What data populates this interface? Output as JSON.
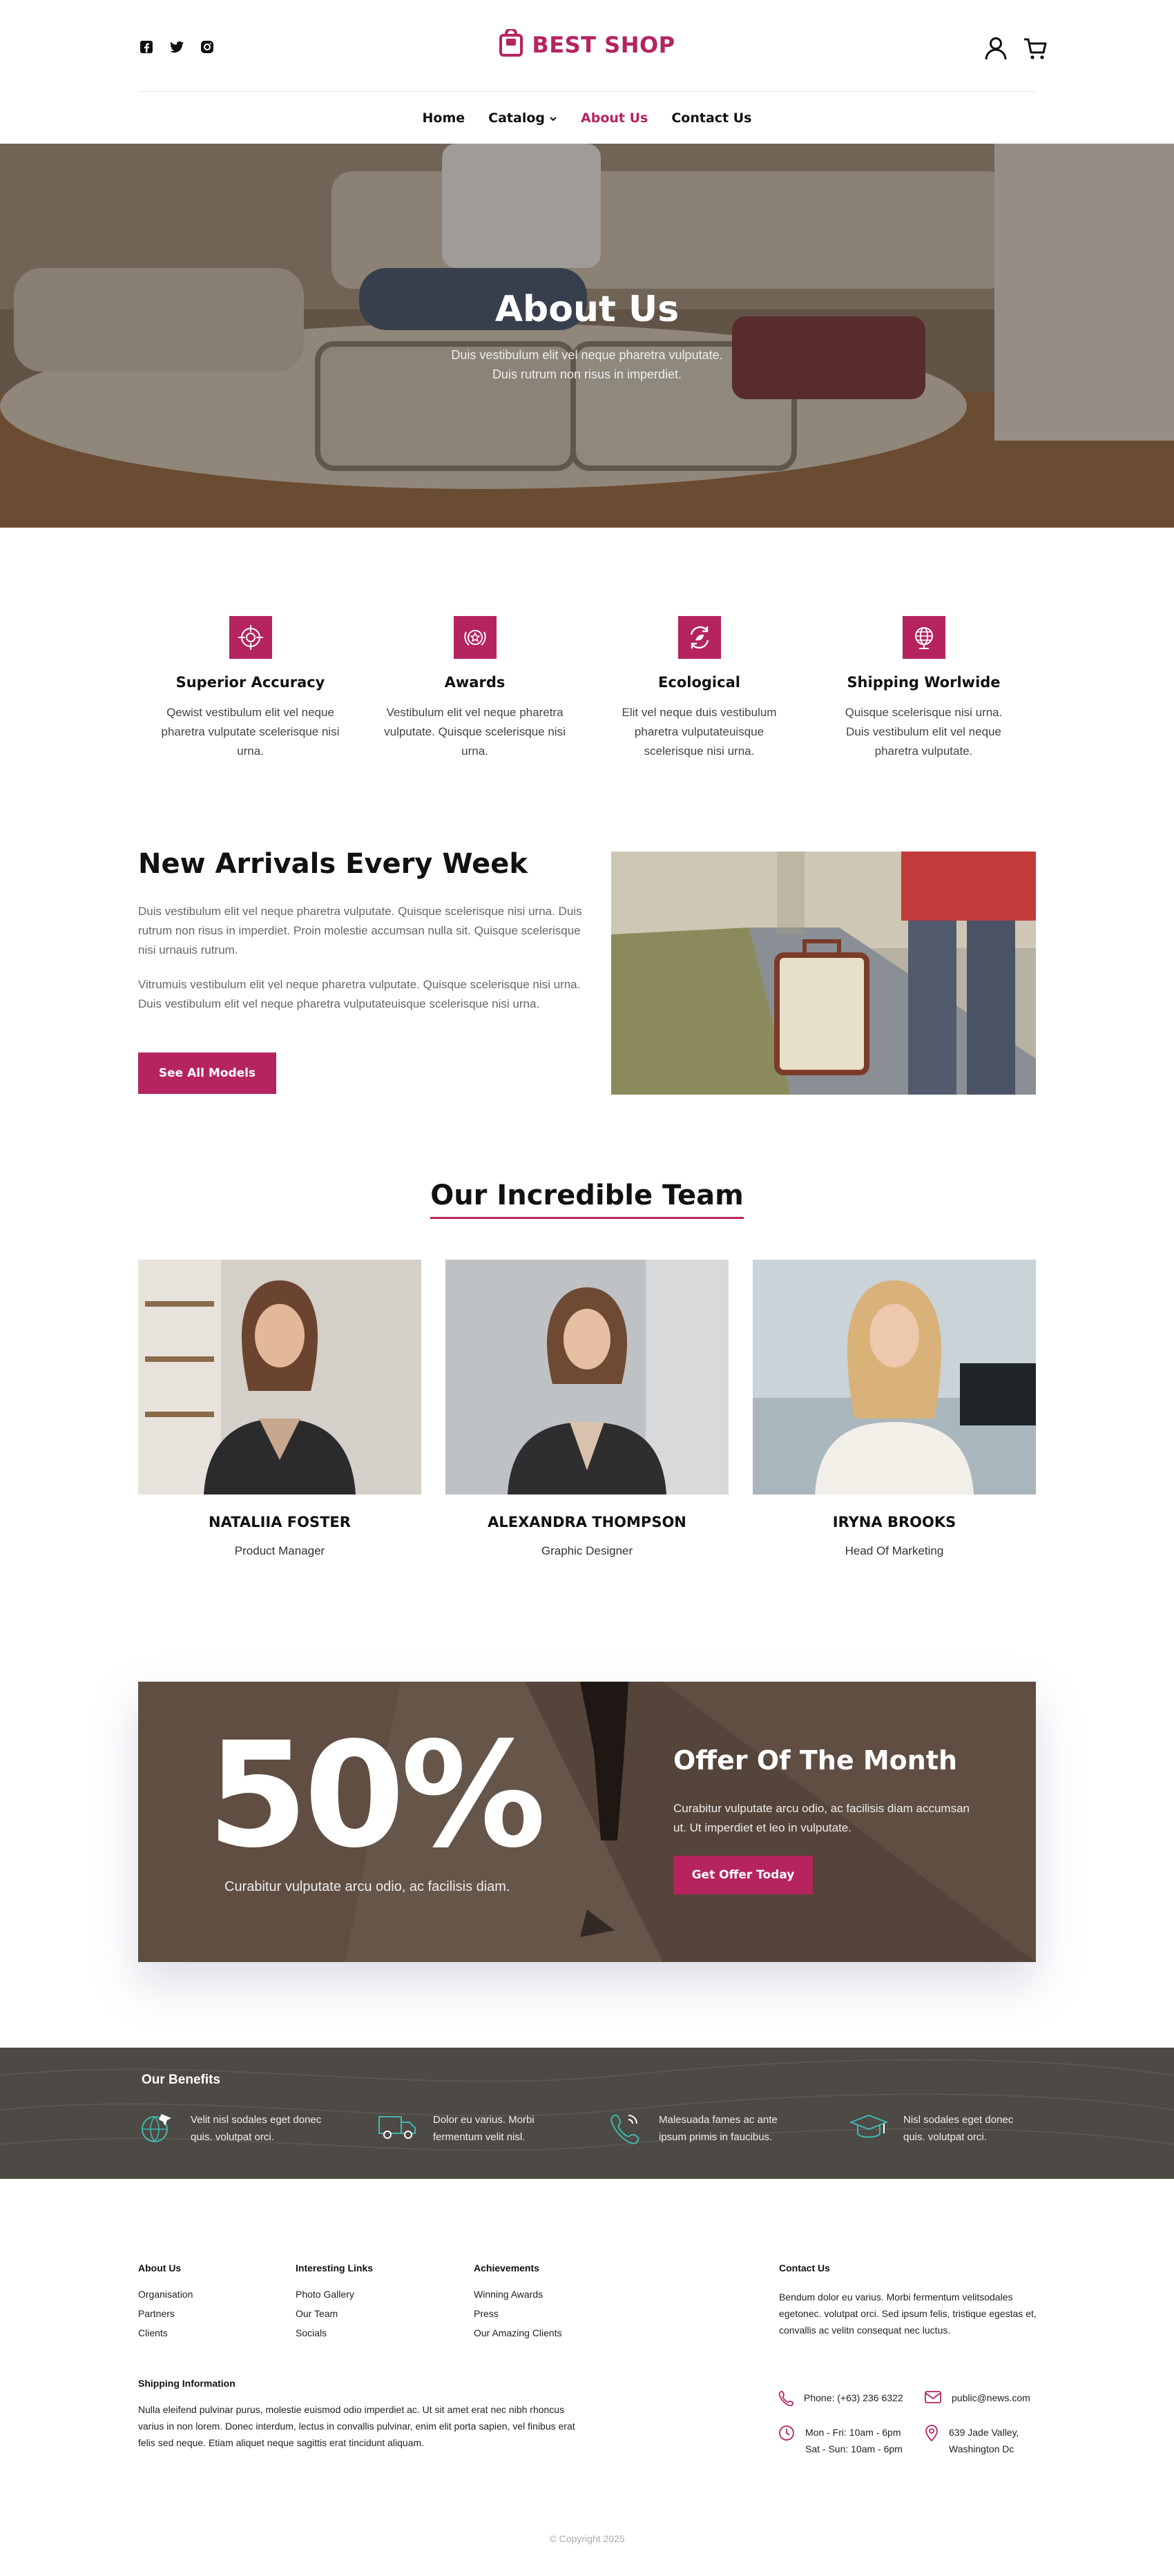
{
  "brand": {
    "name": "BEST SHOP",
    "accent": "#b5245f"
  },
  "header": {
    "social": [
      "facebook-icon",
      "twitter-icon",
      "instagram-icon"
    ],
    "icons": [
      "user-icon",
      "cart-icon"
    ]
  },
  "nav": {
    "items": [
      {
        "label": "Home"
      },
      {
        "label": "Catalog"
      },
      {
        "label": "About Us"
      },
      {
        "label": "Contact Us"
      }
    ],
    "active": "About Us"
  },
  "hero": {
    "title": "About Us",
    "line1": "Duis vestibulum elit vel neque pharetra vulputate.",
    "line2": "Duis rutrum non risus in imperdiet."
  },
  "features": [
    {
      "icon": "target-icon",
      "title": "Superior Accuracy",
      "text": "Qewist vestibulum elit vel neque pharetra vulputate scelerisque nisi urna."
    },
    {
      "icon": "award-icon",
      "title": "Awards",
      "text": "Vestibulum elit vel neque pharetra vulputate. Quisque scelerisque nisi urna."
    },
    {
      "icon": "recycle-icon",
      "title": "Ecological",
      "text": "Elit vel neque duis vestibulum pharetra vulputateuisque scelerisque nisi urna."
    },
    {
      "icon": "globe-icon",
      "title": "Shipping Worlwide",
      "text": "Quisque scelerisque nisi urna. Duis vestibulum elit vel neque pharetra vulputate."
    }
  ],
  "arrivals": {
    "title": "New Arrivals Every Week",
    "p1": "Duis vestibulum elit vel neque pharetra vulputate. Quisque scelerisque nisi urna. Duis rutrum non risus in imperdiet. Proin molestie accumsan nulla sit. Quisque scelerisque nisi urnauis rutrum.",
    "p2": "Vitrumuis vestibulum elit vel neque pharetra vulputate. Quisque scelerisque nisi urna. Duis vestibulum elit vel neque pharetra vulputateuisque scelerisque nisi urna.",
    "button": "See All Models"
  },
  "team": {
    "title": "Our Incredible Team",
    "members": [
      {
        "name": "NATALIIA FOSTER",
        "role": "Product Manager"
      },
      {
        "name": "ALEXANDRA THOMPSON",
        "role": "Graphic Designer"
      },
      {
        "name": "IRYNA BROOKS",
        "role": "Head Of Marketing"
      }
    ]
  },
  "offer": {
    "percent": "50%",
    "percent_sub": "Curabitur vulputate arcu odio, ac facilisis diam.",
    "title": "Offer Of The Month",
    "text": "Curabitur vulputate arcu odio, ac facilisis diam accumsan ut. Ut imperdiet et leo in vulputate.",
    "button": "Get Offer Today"
  },
  "benefits": {
    "title": "Our Benefits",
    "items": [
      {
        "icon": "globe-plane-icon",
        "text": "Velit nisl sodales eget donec quis. volutpat orci."
      },
      {
        "icon": "delivery-truck-icon",
        "text": "Dolor eu varius. Morbi fermentum velit nisl."
      },
      {
        "icon": "phone-icon",
        "text": "Malesuada fames ac ante ipsum primis in faucibus."
      },
      {
        "icon": "graduation-cap-icon",
        "text": "Nisl sodales eget donec quis. volutpat orci."
      }
    ]
  },
  "footer": {
    "about": {
      "title": "About Us",
      "links": [
        "Organisation",
        "Partners",
        "Clients"
      ]
    },
    "interesting": {
      "title": "Interesting Links",
      "links": [
        "Photo Gallery",
        "Our Team",
        "Socials"
      ]
    },
    "achievements": {
      "title": "Achievements",
      "links": [
        "Winning Awards",
        "Press",
        "Our Amazing Clients"
      ]
    },
    "contact": {
      "title": "Contact Us",
      "text": "Bendum dolor eu varius. Morbi fermentum velitsodales egetonec. volutpat orci. Sed ipsum felis, tristique egestas et, convallis ac velitn consequat nec luctus.",
      "phone": "Phone: (+63) 236 6322",
      "email": "public@news.com",
      "hours1": "Mon - Fri: 10am - 6pm",
      "hours2": "Sat - Sun: 10am - 6pm",
      "address1": "639 Jade Valley,",
      "address2": "Washington Dc"
    },
    "shipping": {
      "title": "Shipping Information",
      "text": "Nulla eleifend pulvinar purus, molestie euismod odio imperdiet ac. Ut sit amet erat nec nibh rhoncus varius in non lorem. Donec interdum, lectus in convallis pulvinar, enim elit porta sapien, vel finibus erat felis sed neque. Etiam aliquet neque sagittis erat tincidunt aliquam."
    },
    "copyright": "© Copyright 2025"
  }
}
